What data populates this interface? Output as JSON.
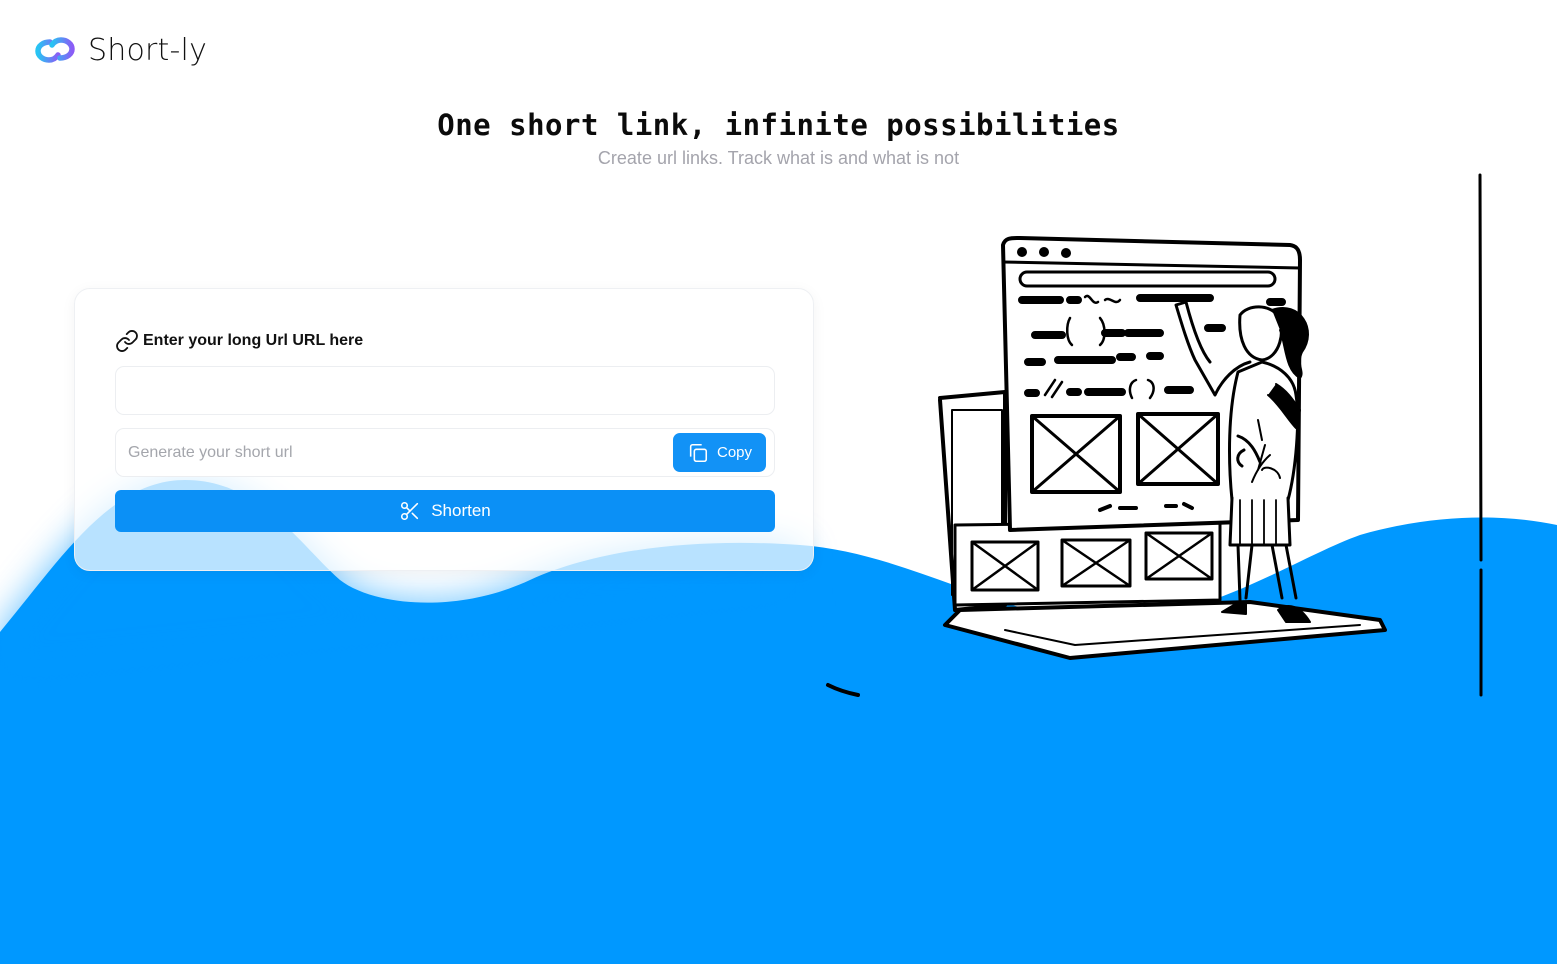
{
  "brand": {
    "name": "Short-ly",
    "logo_icon": "infinity-link-icon"
  },
  "hero": {
    "title": "One short link, infinite possibilities",
    "subtitle": "Create url links. Track what is and what is not"
  },
  "form": {
    "label": "Enter your long Url URL here",
    "label_icon": "link-icon",
    "long_url": {
      "value": "",
      "placeholder": ""
    },
    "short_url": {
      "value": "",
      "placeholder": "Generate your short url"
    },
    "copy_button": {
      "label": "Copy",
      "icon": "copy-icon"
    },
    "shorten_button": {
      "label": "Shorten",
      "icon": "scissors-icon"
    }
  },
  "illustration": {
    "name": "developer-wireframe-illustration"
  },
  "colors": {
    "accent": "#0b90f6",
    "wave": "#0098ff",
    "subtitle": "#a4a4ac"
  }
}
